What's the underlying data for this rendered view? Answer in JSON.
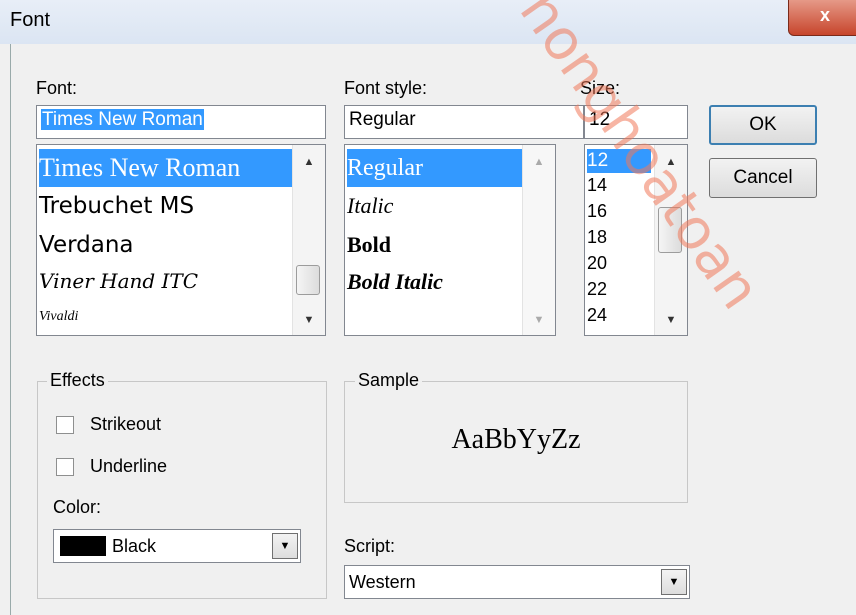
{
  "window": {
    "title": "Font",
    "close_label": "x"
  },
  "font": {
    "label": "Font:",
    "value": "Times New Roman",
    "items": [
      "Times New Roman",
      "Trebuchet MS",
      "Verdana",
      "Viner Hand ITC",
      "Vivaldi"
    ],
    "selected_index": 0
  },
  "style": {
    "label": "Font style:",
    "value": "Regular",
    "items": [
      "Regular",
      "Italic",
      "Bold",
      "Bold Italic"
    ],
    "selected_index": 0
  },
  "size": {
    "label": "Size:",
    "value": "12",
    "items": [
      "12",
      "14",
      "16",
      "18",
      "20",
      "22",
      "24"
    ],
    "selected_index": 0
  },
  "buttons": {
    "ok": "OK",
    "cancel": "Cancel"
  },
  "effects": {
    "title": "Effects",
    "strikeout": "Strikeout",
    "underline": "Underline",
    "strikeout_checked": false,
    "underline_checked": false,
    "color_label": "Color:",
    "color_value": "Black",
    "color_hex": "#000000"
  },
  "sample": {
    "title": "Sample",
    "text": "AaBbYyZz"
  },
  "script": {
    "label": "Script:",
    "value": "Western"
  },
  "watermark": {
    "text": "honghoatoan"
  }
}
